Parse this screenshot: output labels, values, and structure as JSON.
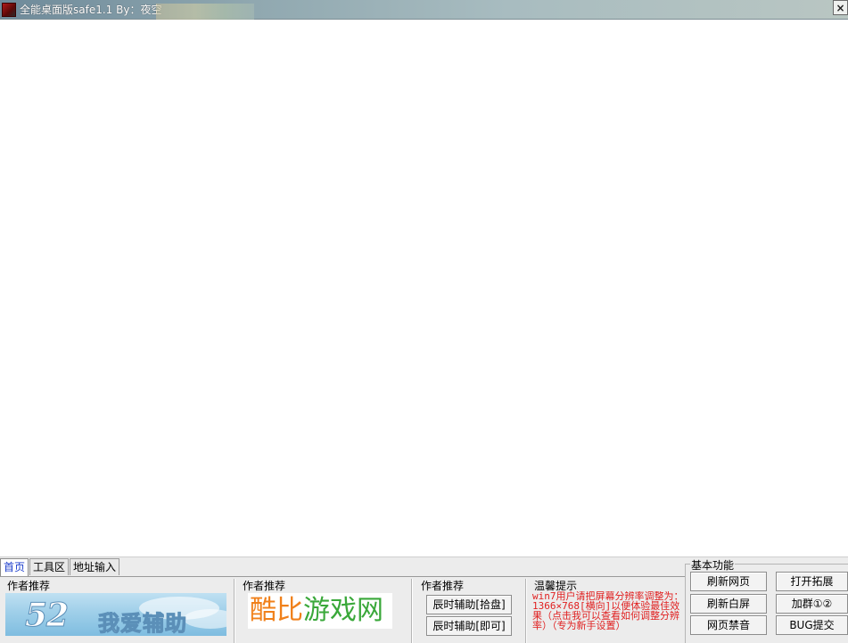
{
  "window": {
    "title": "全能桌面版safe1.1  By：夜空",
    "close_label": "×"
  },
  "tabs": [
    {
      "label": "首页",
      "active": true
    },
    {
      "label": "工具区",
      "active": false
    },
    {
      "label": "地址输入",
      "active": false
    }
  ],
  "home": {
    "group1_label": "作者推荐",
    "group2_label": "作者推荐",
    "group3_label": "作者推荐",
    "tip_label": "温馨提示",
    "banner52": {
      "number": "52",
      "text": "我爱辅助"
    },
    "kubi": {
      "part1": "酷比",
      "part2": "游戏网"
    },
    "btn_assist_pickup": "辰时辅助[拾盘]",
    "btn_assist_instant": "辰时辅助[即可]",
    "tip_text": "win7用户请把屏幕分辨率调整为：1366×768[横向]以便体验最佳效果（点击我可以查看如何调整分辨率）（专为新手设置）"
  },
  "functions": {
    "legend": "基本功能",
    "refresh_page": "刷新网页",
    "open_extension": "打开拓展",
    "refresh_white": "刷新白屏",
    "join_group": "加群①②",
    "mute_page": "网页禁音",
    "bug_submit": "BUG提交"
  },
  "colors": {
    "tab_active_text": "#1c3ecc",
    "tip_text": "#e02020",
    "kubi_orange": "#f0801a",
    "kubi_green": "#3aa83a"
  }
}
